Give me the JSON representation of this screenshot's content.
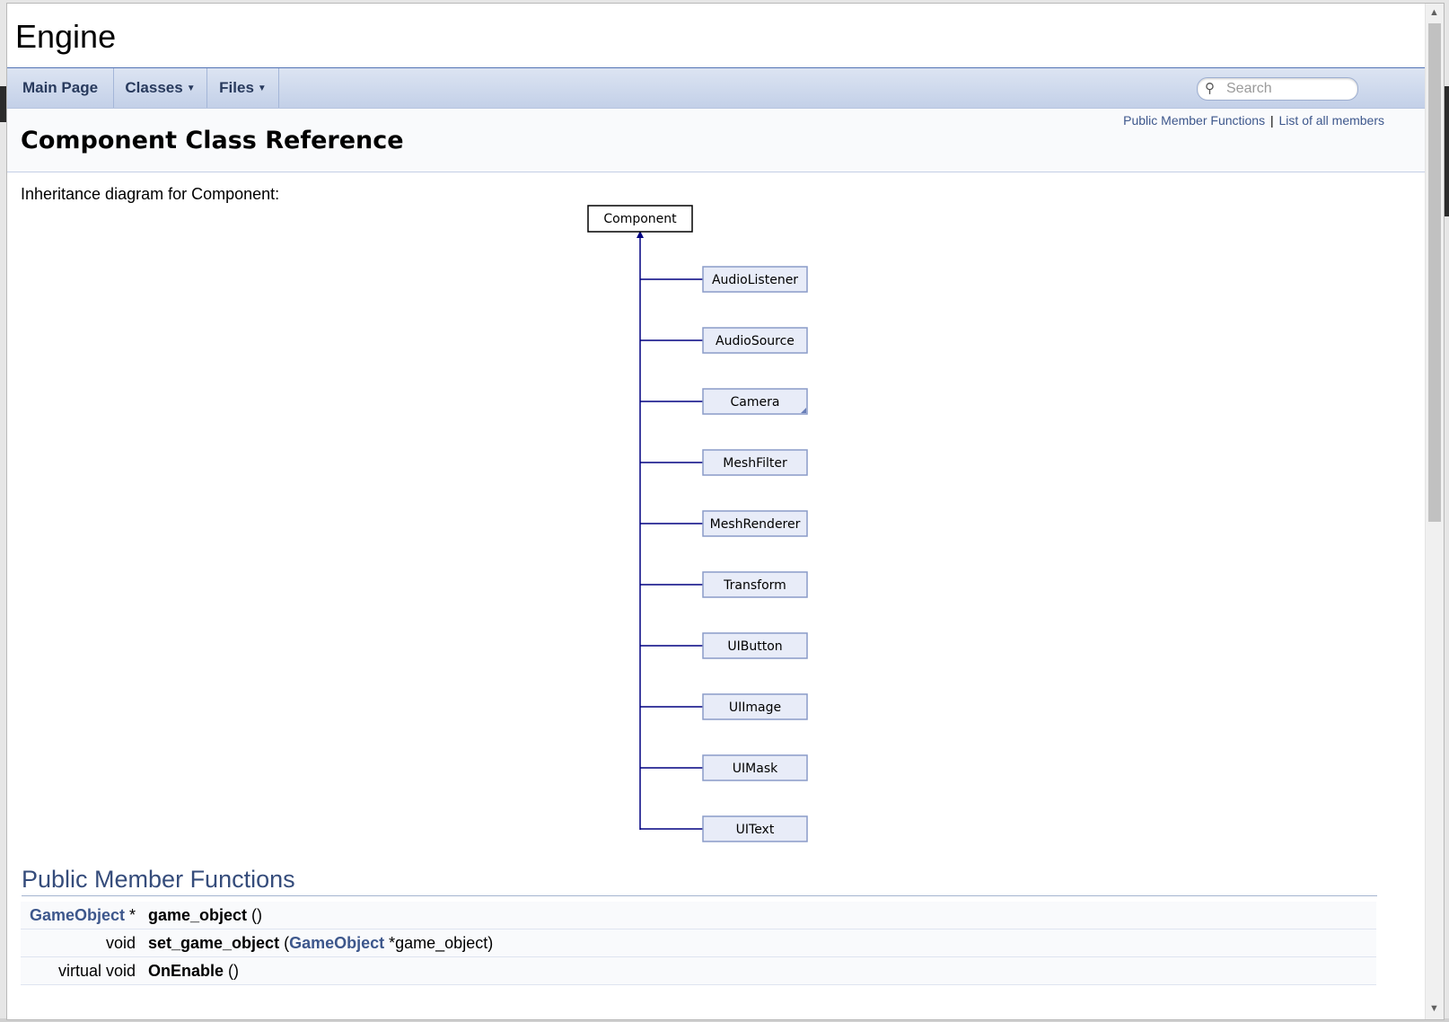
{
  "project": {
    "name": "Engine"
  },
  "navbar": {
    "items": [
      {
        "label": "Main Page"
      },
      {
        "label": "Classes"
      },
      {
        "label": "Files"
      }
    ],
    "search_placeholder": "Search"
  },
  "header": {
    "summary_links": [
      "Public Member Functions",
      "List of all members"
    ],
    "summary_separator": "|",
    "title": "Component Class Reference"
  },
  "inheritance": {
    "label": "Inheritance diagram for Component:",
    "base": "Component",
    "children": [
      "AudioListener",
      "AudioSource",
      "Camera",
      "MeshFilter",
      "MeshRenderer",
      "Transform",
      "UIButton",
      "UIImage",
      "UIMask",
      "UIText"
    ]
  },
  "members": {
    "section_title": "Public Member Functions",
    "rows": [
      {
        "type_link": "GameObject",
        "type_suffix": " *",
        "type": "",
        "name": "game_object",
        "args_prefix": " ()",
        "arg_link": "",
        "args_suffix": ""
      },
      {
        "type_link": "",
        "type_suffix": "",
        "type": "void",
        "name": "set_game_object",
        "args_prefix": " (",
        "arg_link": "GameObject",
        "args_suffix": " *game_object)"
      },
      {
        "type_link": "",
        "type_suffix": "",
        "type": "virtual void",
        "name": "OnEnable",
        "args_prefix": " ()",
        "arg_link": "",
        "args_suffix": ""
      }
    ]
  },
  "colors": {
    "nav_text": "#283a5d",
    "link": "#3d578c",
    "diagram_line": "#000080",
    "child_box_fill": "#e8ecf8"
  }
}
